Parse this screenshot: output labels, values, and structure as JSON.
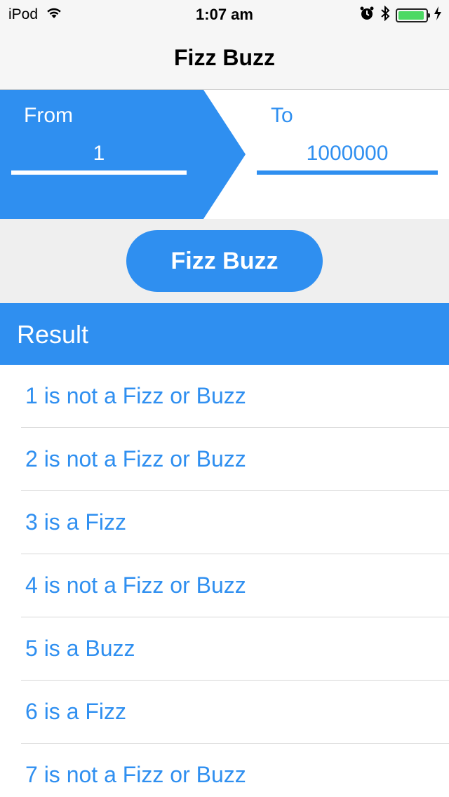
{
  "status_bar": {
    "device": "iPod",
    "time": "1:07 am",
    "battery_level": 0.95,
    "icons": [
      "wifi-icon",
      "alarm-icon",
      "bluetooth-icon",
      "battery-icon",
      "charging-icon"
    ]
  },
  "nav": {
    "title": "Fizz Buzz"
  },
  "range": {
    "from_label": "From",
    "from_value": "1",
    "to_label": "To",
    "to_value": "1000000"
  },
  "action": {
    "button_label": "Fizz Buzz"
  },
  "result": {
    "title": "Result",
    "items": [
      "1 is not a Fizz or Buzz",
      "2 is not a Fizz or Buzz",
      "3 is a Fizz",
      "4 is not a Fizz or Buzz",
      "5 is a Buzz",
      "6 is a Fizz",
      "7 is not a Fizz or Buzz"
    ]
  },
  "colors": {
    "accent": "#2f8ff0",
    "band": "#efefef",
    "nav_bg": "#f6f6f6",
    "battery": "#4cd964"
  }
}
